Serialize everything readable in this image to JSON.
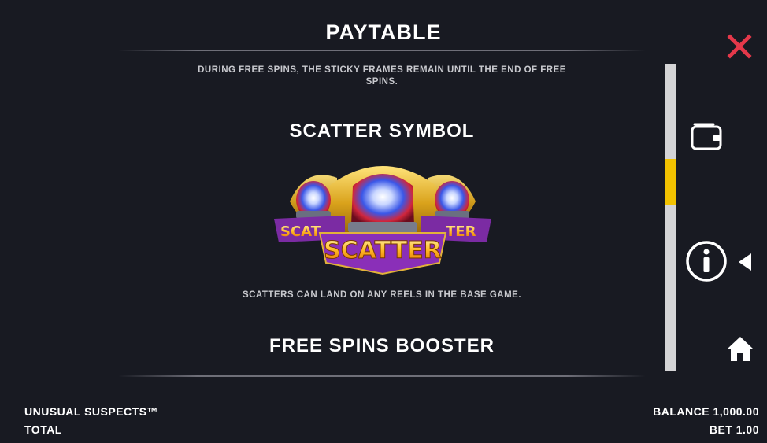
{
  "header": {
    "title": "PAYTABLE"
  },
  "content": {
    "free_spins_note": "DURING FREE SPINS, THE STICKY FRAMES REMAIN UNTIL THE END OF FREE SPINS.",
    "scatter_heading": "SCATTER SYMBOL",
    "scatter_logo_text": "SCATTER",
    "scatter_description": "SCATTERS CAN LAND ON ANY REELS IN THE BASE GAME.",
    "booster_heading": "FREE SPINS BOOSTER"
  },
  "scrollbar": {
    "position_fraction": 0.31
  },
  "side_menu": {
    "icons": [
      "close-icon",
      "wallet-icon",
      "info-icon",
      "caret-left-icon",
      "home-icon"
    ]
  },
  "footer": {
    "game_name": "UNUSUAL SUSPECTS™",
    "total_label": "TOTAL",
    "balance_label": "BALANCE",
    "balance_value": "1,000.00",
    "bet_label": "BET",
    "bet_value": "1.00"
  },
  "colors": {
    "background": "#181a22",
    "accent_close": "#e5384a",
    "scroll_thumb": "#f2c200",
    "scroll_track": "#d4d4d6",
    "text_primary": "#ffffff",
    "text_secondary": "#c8c9ce"
  }
}
